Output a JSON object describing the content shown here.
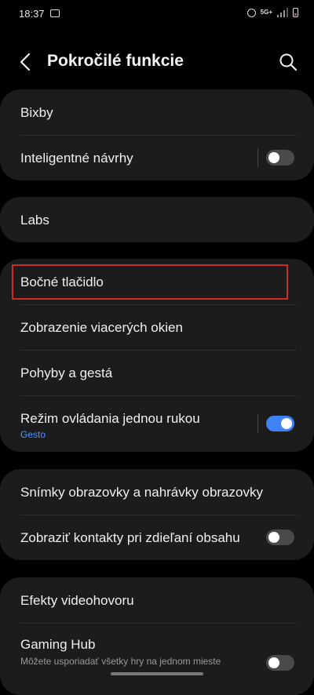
{
  "status_bar": {
    "time": "18:37",
    "network": "5G+",
    "icons": [
      "image-icon",
      "alarm-icon",
      "signal-icon",
      "battery-icon"
    ]
  },
  "header": {
    "title": "Pokročilé funkcie",
    "back_icon": "back-arrow-icon",
    "search_icon": "search-icon"
  },
  "groups": {
    "g1": {
      "bixby": "Bixby",
      "suggestions": "Inteligentné návrhy",
      "suggestions_toggle": "off"
    },
    "g2": {
      "labs": "Labs"
    },
    "g3": {
      "side_button": "Bočné tlačidlo",
      "multi_window": "Zobrazenie viacerých okien",
      "motions": "Pohyby a gestá",
      "one_hand": "Režim ovládania jednou rukou",
      "one_hand_sub": "Gesto",
      "one_hand_toggle": "on"
    },
    "g4": {
      "screenshots": "Snímky obrazovky a nahrávky obrazovky",
      "share_contacts": "Zobraziť kontakty pri zdieľaní obsahu",
      "share_contacts_toggle": "off"
    },
    "g5": {
      "video_effects": "Efekty videohovoru",
      "gaming_hub": "Gaming Hub",
      "gaming_hub_sub": "Môžete usporiadať všetky hry na jednom mieste",
      "gaming_hub_toggle": "off"
    }
  },
  "colors": {
    "background": "#000000",
    "card": "#1c1c1c",
    "accent": "#3e82f7",
    "highlight": "#d02a2a"
  }
}
